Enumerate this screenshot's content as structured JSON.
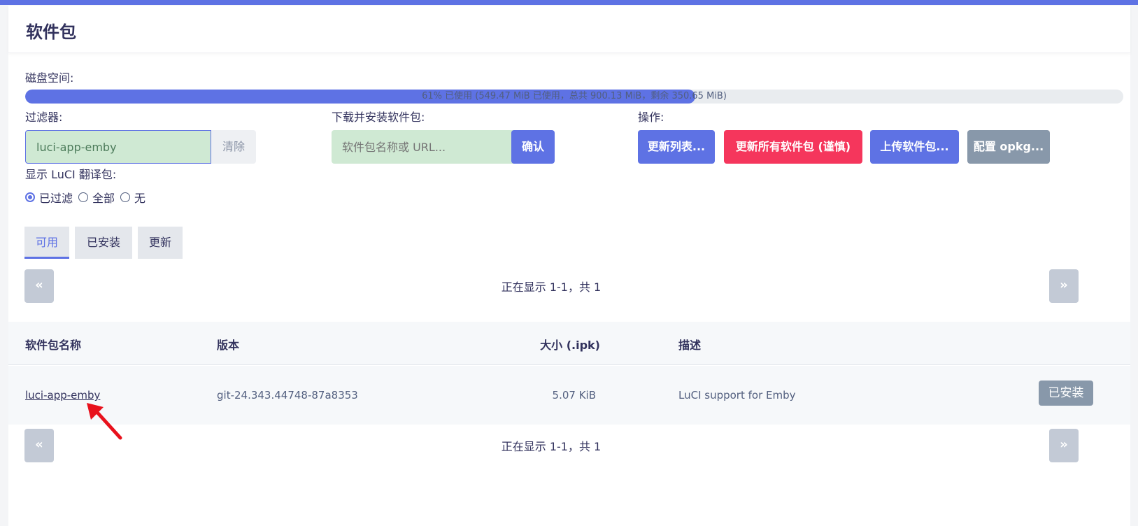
{
  "page": {
    "title": "软件包"
  },
  "disk": {
    "label": "磁盘空间:",
    "percent": 61,
    "text": "61% 已使用 (549.47 MiB 已使用，总共 900.13 MiB，剩余 350.65 MiB)"
  },
  "filter": {
    "label": "过滤器:",
    "value": "luci-app-emby",
    "clear_label": "清除"
  },
  "download": {
    "label": "下载并安装软件包:",
    "placeholder": "软件包名称或 URL...",
    "confirm_label": "确认"
  },
  "actions": {
    "label": "操作:",
    "update_lists": "更新列表...",
    "upgrade_all": "更新所有软件包 (谨慎)",
    "upload": "上传软件包...",
    "configure": "配置 opkg..."
  },
  "translations": {
    "label": "显示 LuCI 翻译包:",
    "options": [
      "已过滤",
      "全部",
      "无"
    ],
    "selected": "已过滤"
  },
  "tabs": [
    "可用",
    "已安装",
    "更新"
  ],
  "active_tab": "可用",
  "pager": {
    "prev": "«",
    "next": "»",
    "status": "正在显示 1-1，共 1"
  },
  "table": {
    "headers": {
      "name": "软件包名称",
      "version": "版本",
      "size": "大小 (.ipk)",
      "description": "描述"
    },
    "rows": [
      {
        "name": "luci-app-emby",
        "version": "git-24.343.44748-87a8353",
        "size": "5.07 KiB",
        "description": "LuCI support for Emby",
        "action": "已安装"
      }
    ]
  },
  "colors": {
    "primary": "#5e72e4",
    "danger": "#f5365c",
    "secondary": "#8898aa",
    "annotation": "#e8111c"
  }
}
